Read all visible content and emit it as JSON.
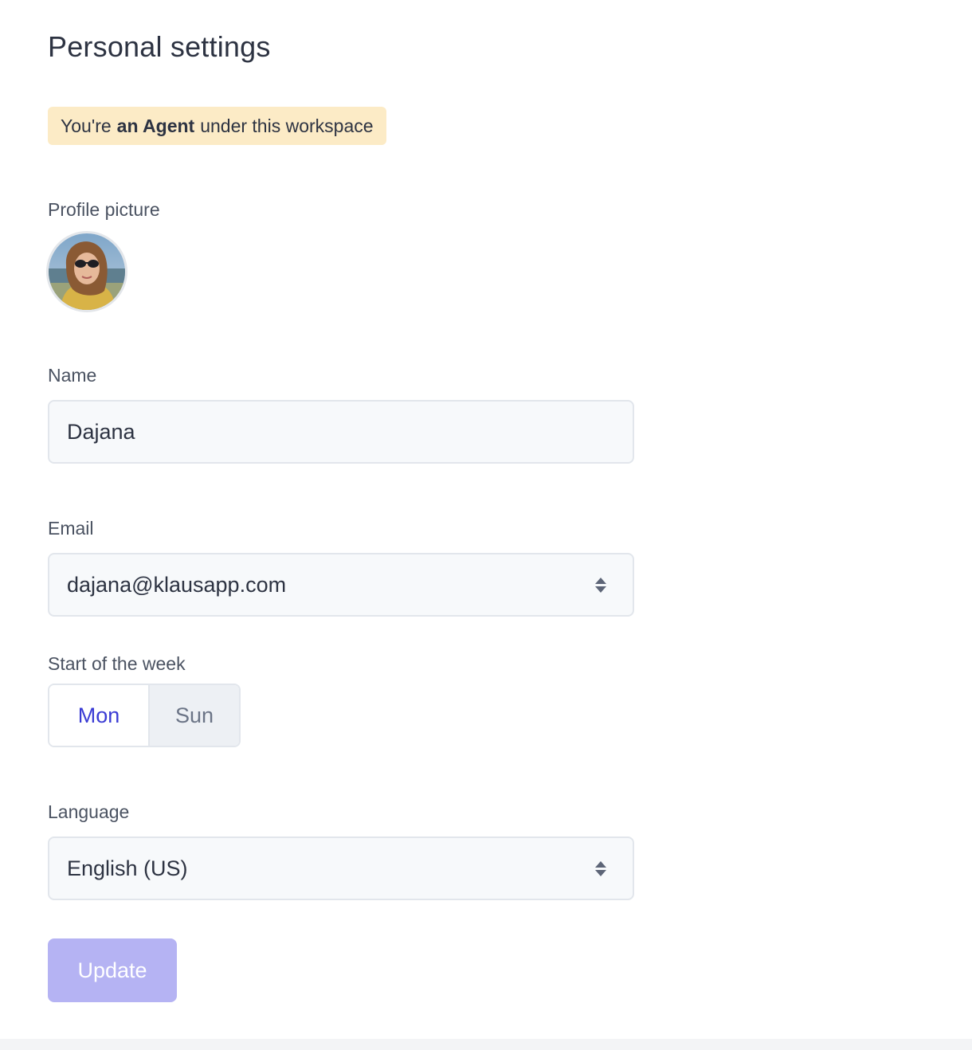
{
  "page": {
    "title": "Personal settings"
  },
  "role_banner": {
    "prefix": "You're",
    "role": "an Agent",
    "suffix": "under this workspace"
  },
  "profile_picture": {
    "label": "Profile picture"
  },
  "name": {
    "label": "Name",
    "value": "Dajana"
  },
  "email": {
    "label": "Email",
    "value": "dajana@klausapp.com",
    "icon": "select-arrows-icon"
  },
  "week_start": {
    "label": "Start of the week",
    "options": [
      "Mon",
      "Sun"
    ],
    "selected": "Mon"
  },
  "language": {
    "label": "Language",
    "value": "English (US)",
    "icon": "select-arrows-icon"
  },
  "actions": {
    "update_label": "Update"
  },
  "colors": {
    "banner_bg": "#fcebc6",
    "accent": "#3a3bd4",
    "button_disabled_bg": "#b5b3f3"
  }
}
